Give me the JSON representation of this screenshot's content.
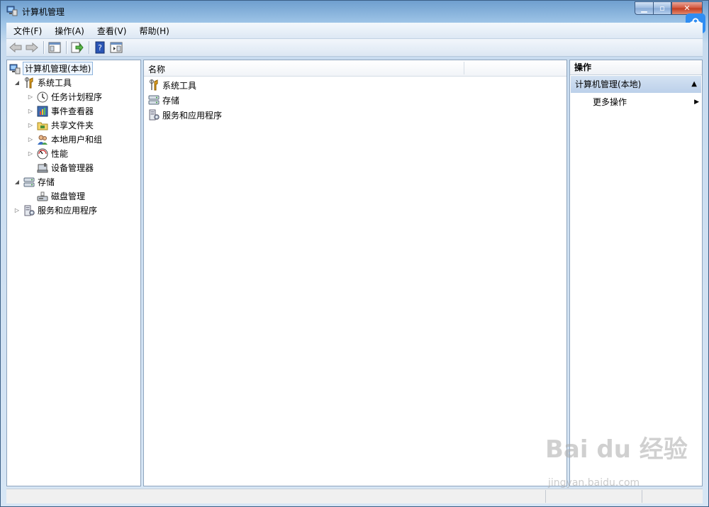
{
  "window": {
    "title": "计算机管理"
  },
  "menu": [
    {
      "label": "文件(F)"
    },
    {
      "label": "操作(A)"
    },
    {
      "label": "查看(V)"
    },
    {
      "label": "帮助(H)"
    }
  ],
  "tree": [
    {
      "label": "计算机管理(本地)",
      "level": 0,
      "expander": "",
      "icon": "computer-management-icon",
      "selected": true
    },
    {
      "label": "系统工具",
      "level": 1,
      "expander": "expanded",
      "icon": "system-tools-icon"
    },
    {
      "label": "任务计划程序",
      "level": 2,
      "expander": "collapsed",
      "icon": "task-scheduler-icon"
    },
    {
      "label": "事件查看器",
      "level": 2,
      "expander": "collapsed",
      "icon": "event-viewer-icon"
    },
    {
      "label": "共享文件夹",
      "level": 2,
      "expander": "collapsed",
      "icon": "shared-folders-icon"
    },
    {
      "label": "本地用户和组",
      "level": 2,
      "expander": "collapsed",
      "icon": "local-users-icon"
    },
    {
      "label": "性能",
      "level": 2,
      "expander": "collapsed",
      "icon": "performance-icon"
    },
    {
      "label": "设备管理器",
      "level": 2,
      "expander": "",
      "icon": "device-manager-icon"
    },
    {
      "label": "存储",
      "level": 1,
      "expander": "expanded",
      "icon": "storage-icon"
    },
    {
      "label": "磁盘管理",
      "level": 2,
      "expander": "",
      "icon": "disk-management-icon"
    },
    {
      "label": "服务和应用程序",
      "level": 1,
      "expander": "collapsed",
      "icon": "services-apps-icon"
    }
  ],
  "list": {
    "column_name": "名称",
    "rows": [
      {
        "label": "系统工具",
        "icon": "system-tools-icon"
      },
      {
        "label": "存储",
        "icon": "storage-icon"
      },
      {
        "label": "服务和应用程序",
        "icon": "services-apps-icon"
      }
    ]
  },
  "actions": {
    "header": "操作",
    "group": "计算机管理(本地)",
    "item": "更多操作"
  },
  "watermark": {
    "logo": "Bai du 经验",
    "url": "jingyan.baidu.com"
  }
}
